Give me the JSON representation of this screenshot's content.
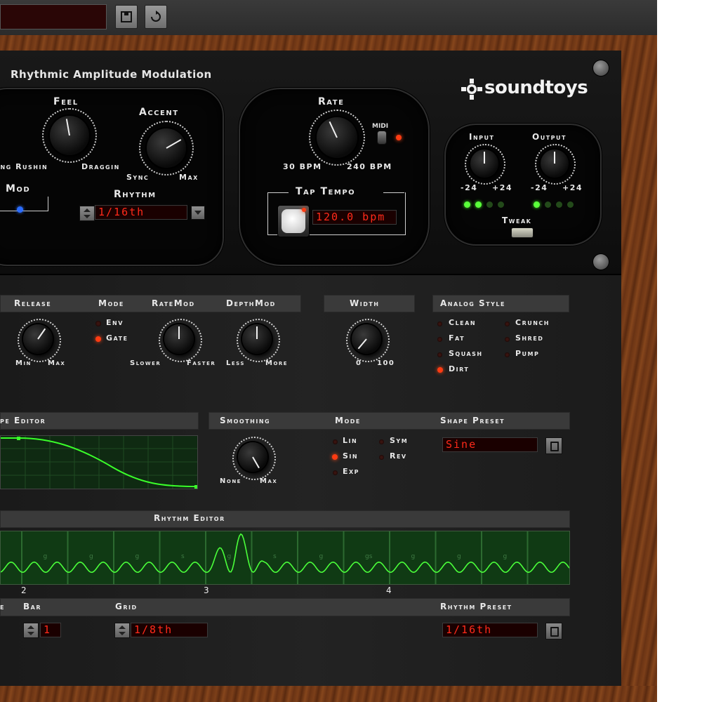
{
  "toolbar": {
    "save_icon": "save-icon",
    "reset_icon": "reset-icon"
  },
  "plugin": {
    "title": "Rhythmic Amplitude Modulation",
    "brand": "soundtoys"
  },
  "feel": {
    "label": "Feel",
    "left": "ing Rushin",
    "right": "Draggin"
  },
  "accent": {
    "label": "Accent",
    "left": "Sync",
    "right": "Max"
  },
  "mod": {
    "label": "Mod"
  },
  "rhythm": {
    "label": "Rhythm",
    "value": "1/16th"
  },
  "rate": {
    "label": "Rate",
    "left": "30 BPM",
    "right": "240 BPM",
    "midi": "MIDI"
  },
  "tap_tempo": {
    "label": "Tap Tempo",
    "value": "120.0 bpm"
  },
  "io": {
    "input": "Input",
    "output": "Output",
    "min": "-24",
    "max": "+24",
    "tweak": "Tweak",
    "input_meter": [
      "on",
      "on",
      "off",
      "off"
    ],
    "output_meter": [
      "on",
      "off",
      "off",
      "off"
    ]
  },
  "dynamics": {
    "release": {
      "label": "Release",
      "left": "Min",
      "right": "Max"
    },
    "mode": {
      "label": "Mode",
      "options": [
        "Env",
        "Gate"
      ],
      "selected": "Gate"
    },
    "ratemod": {
      "label": "RateMod",
      "left": "Slower",
      "right": "Faster"
    },
    "depthmod": {
      "label": "DepthMod",
      "left": "Less",
      "right": "More"
    }
  },
  "width": {
    "label": "Width",
    "left": "0",
    "right": "100"
  },
  "analog_style": {
    "label": "Analog Style",
    "options": [
      "Clean",
      "Crunch",
      "Fat",
      "Shred",
      "Squash",
      "Pump",
      "Dirt"
    ],
    "selected": "Dirt"
  },
  "shape_editor": {
    "label": "pe Editor"
  },
  "smoothing": {
    "label": "Smoothing",
    "left": "None",
    "right": "Max"
  },
  "shape_mode": {
    "label": "Mode",
    "options": [
      "Lin",
      "Sym",
      "Sin",
      "Rev",
      "Exp"
    ],
    "selected": "Sin"
  },
  "shape_preset": {
    "label": "Shape Preset",
    "value": "Sine"
  },
  "rhythm_editor": {
    "label": "Rhythm Editor",
    "markers": [
      "2",
      "3",
      "4"
    ],
    "cell_letters": [
      "g",
      "g",
      "g",
      "s",
      "g",
      "s",
      "g",
      "gs",
      "g",
      "g",
      "g"
    ]
  },
  "bar": {
    "label": "Bar",
    "value": "1",
    "cut_label": "e"
  },
  "grid": {
    "label": "Grid",
    "value": "1/8th"
  },
  "rhythm_preset": {
    "label": "Rhythm Preset",
    "value": "1/16th"
  }
}
